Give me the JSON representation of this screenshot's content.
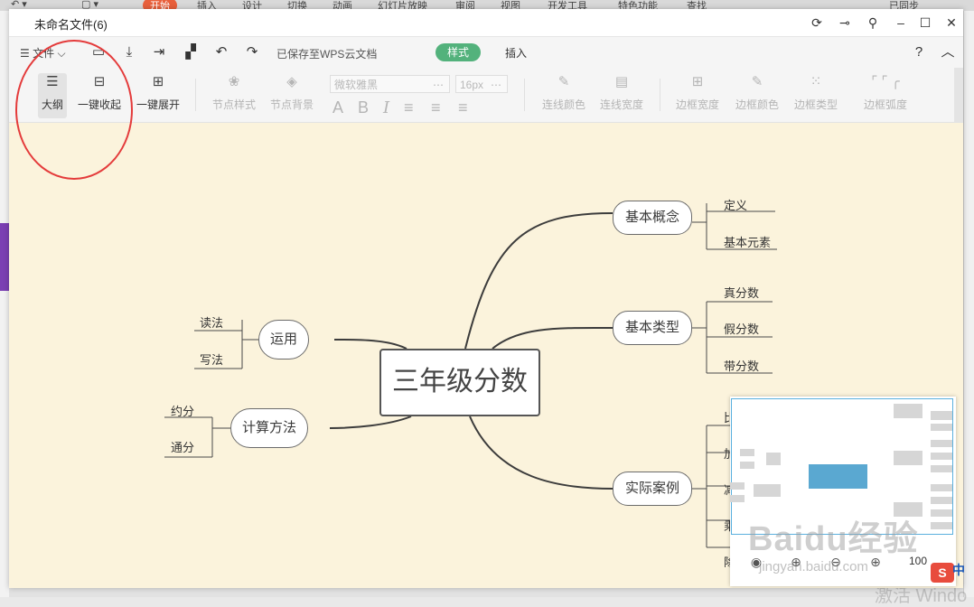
{
  "host": {
    "tabs": [
      "开始",
      "插入",
      "设计",
      "切换",
      "动画",
      "幻灯片放映",
      "审阅",
      "视图",
      "开发工具",
      "特色功能",
      "查找"
    ],
    "sync_label": "已同步",
    "activate_text": "激活 Windo"
  },
  "window": {
    "title": "未命名文件(6)",
    "controls": {
      "refresh": "⟳",
      "pin": "⊸",
      "share": "⚲",
      "minimize": "–",
      "maximize": "☐",
      "close": "✕"
    }
  },
  "menubar": {
    "file_label": "文件",
    "saved_text": "已保存至WPS云文档",
    "style_label": "样式",
    "insert_label": "插入",
    "help_icon": "?",
    "collapse_icon": "︿"
  },
  "ribbon": {
    "outline": "大纲",
    "collapse_all": "一键收起",
    "expand_all": "一键展开",
    "node_style": "节点样式",
    "node_bg": "节点背景",
    "font_name": "微软雅黑",
    "font_size": "16px",
    "line_color": "连线颜色",
    "line_width": "连线宽度",
    "border_width": "边框宽度",
    "border_color": "边框颜色",
    "border_type": "边框类型",
    "border_radius": "边框弧度"
  },
  "mindmap": {
    "root": "三年级分数",
    "branches": {
      "concept": {
        "label": "基本概念",
        "leaves": [
          "定义",
          "基本元素"
        ]
      },
      "type": {
        "label": "基本类型",
        "leaves": [
          "真分数",
          "假分数",
          "带分数"
        ]
      },
      "case": {
        "label": "实际案例",
        "leaves": [
          "比",
          "加",
          "减",
          "乘",
          "除"
        ]
      },
      "use": {
        "label": "运用",
        "leaves": [
          "读法",
          "写法"
        ]
      },
      "calc": {
        "label": "计算方法",
        "leaves": [
          "约分",
          "通分"
        ]
      }
    }
  },
  "minimap": {
    "zoom": "100",
    "ime_mark": "S",
    "ime_lang": "中",
    "watermark": "Baidu经验",
    "watermark_url": "jingyan.baidu.com"
  },
  "colors": {
    "annotation": "#e43b3b",
    "style_button": "#53b27c",
    "canvas_bg": "#fbf3dc",
    "minimap_root": "#5aa8d1"
  }
}
